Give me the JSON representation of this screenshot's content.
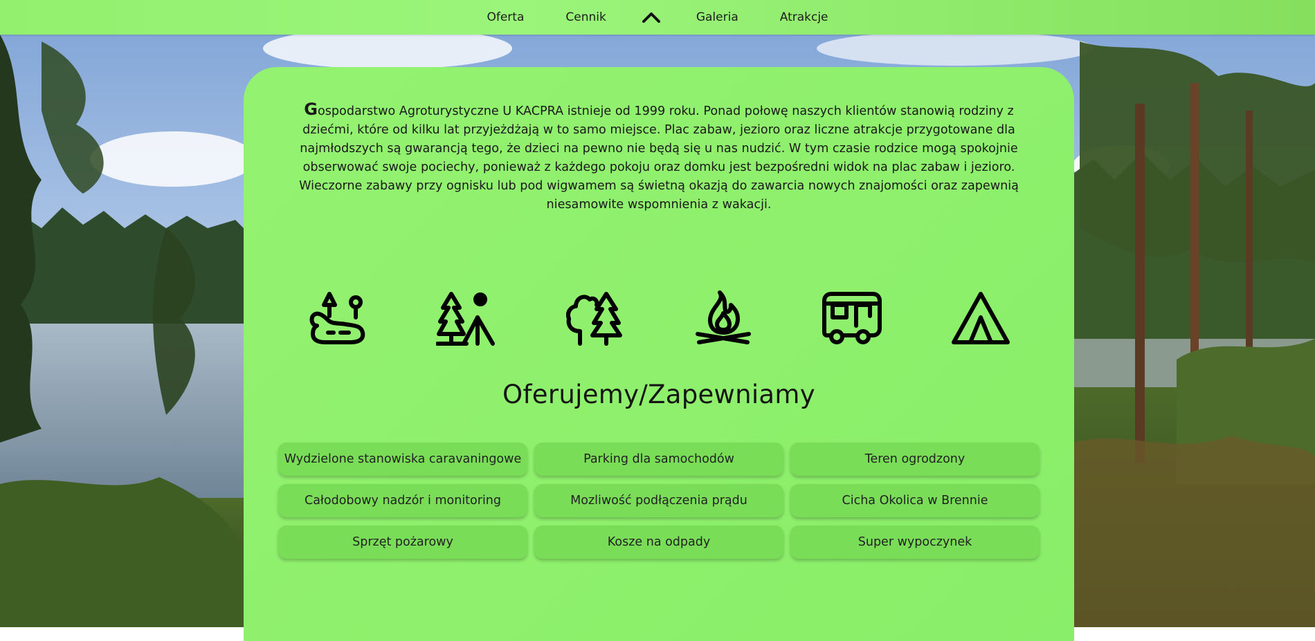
{
  "nav": {
    "items": [
      "Oferta",
      "Cennik",
      "Galeria",
      "Atrakcje"
    ],
    "scroll_top_icon": "chevron-up-icon",
    "background_color": "#93f06e"
  },
  "intro": {
    "dropcap": "G",
    "text": "ospodarstwo Agroturystyczne U KACPRA istnieje od 1999 roku. Ponad połowę naszych klientów stanowią rodziny z dziećmi, które od kilku lat przyjeżdżają w to samo miejsce. Plac zabaw, jezioro oraz liczne atrakcje przygotowane dla najmłodszych są gwarancją tego, że dzieci na pewno nie będą się u nas nudzić. W tym czasie rodzice mogą spokojnie obserwować swoje pociechy, ponieważ z każdego pokoju oraz domku jest bezpośredni widok na plac zabaw i jezioro. Wieczorne zabawy przy ognisku lub pod wigwamem są świetną okazją do zawarcia nowych znajomości oraz zapewnią niesamowite wspomnienia z wakacji."
  },
  "icons": [
    "lake-icon",
    "camper-person-icon",
    "forest-icon",
    "campfire-icon",
    "caravan-icon",
    "tent-icon"
  ],
  "offer": {
    "title": "Oferujemy/Zapewniamy",
    "items": [
      "Wydzielone stanowiska caravaningowe",
      "Parking dla samochodów",
      "Teren ogrodzony",
      "Całodobowy nadzór i monitoring",
      "Mozliwość podłączenia prądu",
      "Cicha Okolica w Brennie",
      "Sprzęt pożarowy",
      "Kosze na odpady",
      "Super wypoczynek"
    ]
  },
  "colors": {
    "card": "#8ef06c",
    "feature_button": "#79dd58",
    "text": "#1a1a1a"
  }
}
